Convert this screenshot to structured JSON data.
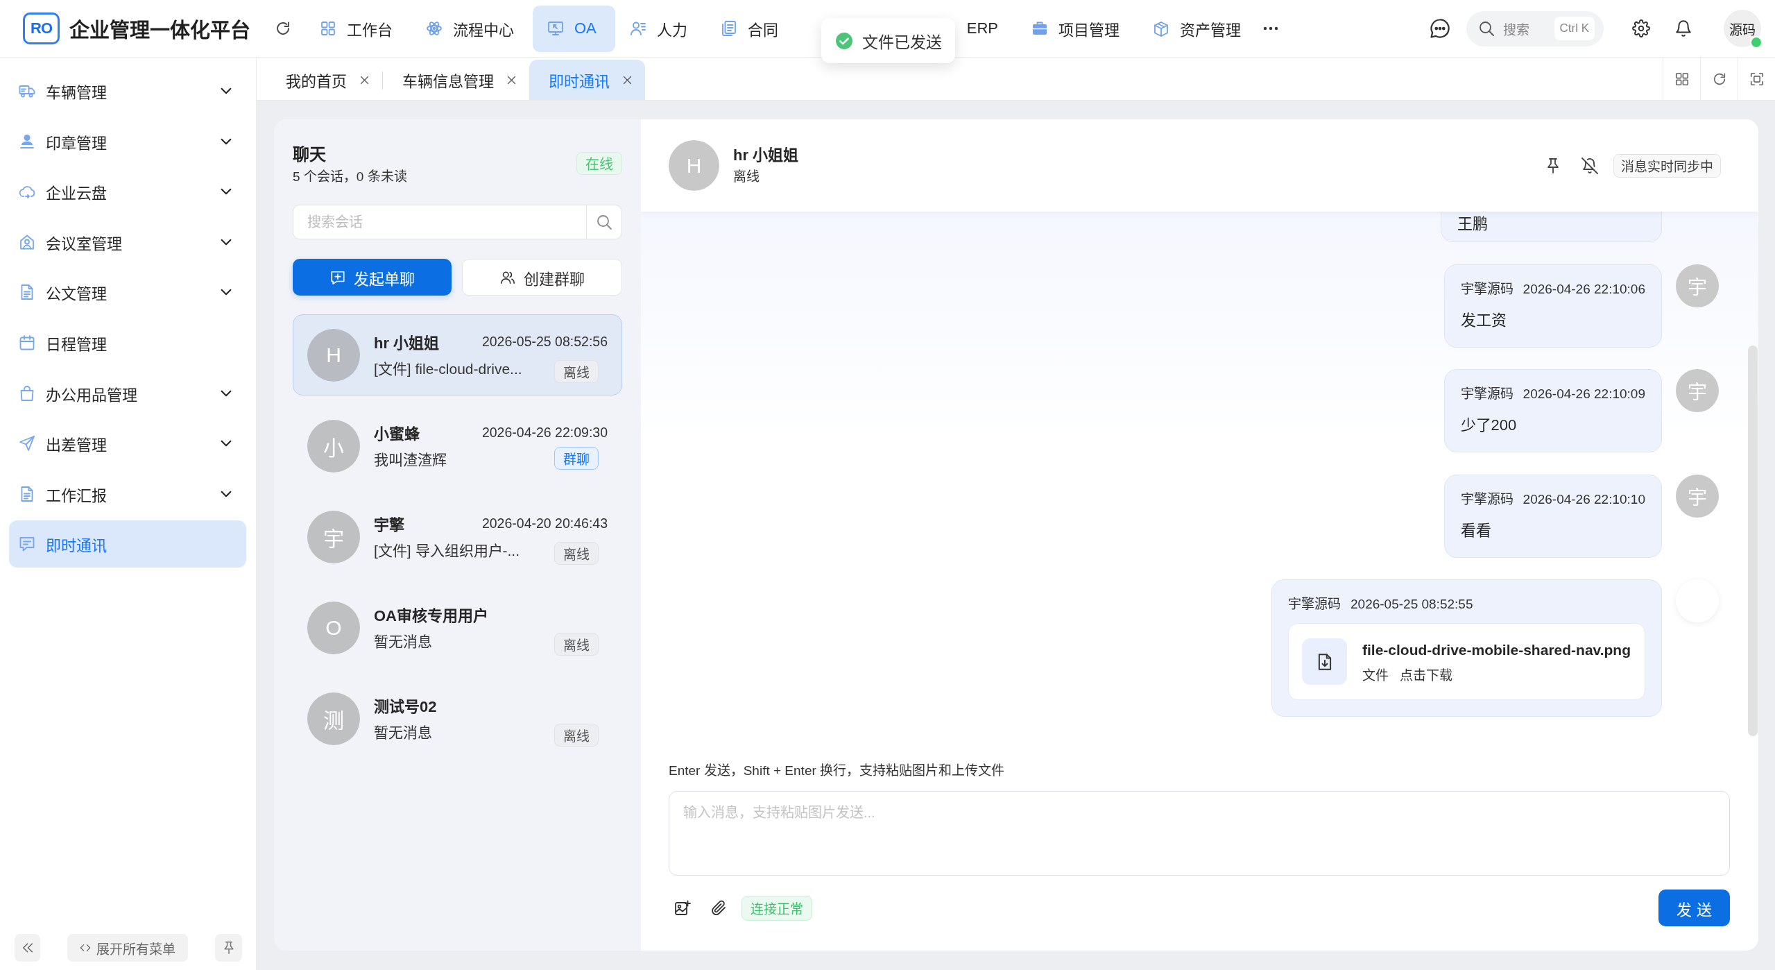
{
  "app": {
    "logo": "RO",
    "title": "企业管理一体化平台"
  },
  "top_nav": [
    {
      "label": "工作台",
      "selected": false
    },
    {
      "label": "流程中心",
      "selected": false
    },
    {
      "label": "OA",
      "selected": true
    },
    {
      "label": "人力",
      "selected": false
    },
    {
      "label": "合同",
      "selected": false
    },
    {
      "label": "ERP",
      "selected": false
    },
    {
      "label": "项目管理",
      "selected": false
    },
    {
      "label": "资产管理",
      "selected": false
    }
  ],
  "topbar": {
    "search": {
      "label": "搜索",
      "shortcut": "Ctrl K"
    },
    "user": {
      "name": "源码",
      "online": true
    }
  },
  "toast": {
    "message": "文件已发送"
  },
  "sidebar": {
    "items": [
      {
        "label": "车辆管理",
        "expandable": true,
        "selected": false
      },
      {
        "label": "印章管理",
        "expandable": true,
        "selected": false
      },
      {
        "label": "企业云盘",
        "expandable": true,
        "selected": false
      },
      {
        "label": "会议室管理",
        "expandable": true,
        "selected": false
      },
      {
        "label": "公文管理",
        "expandable": true,
        "selected": false
      },
      {
        "label": "日程管理",
        "expandable": false,
        "selected": false
      },
      {
        "label": "办公用品管理",
        "expandable": true,
        "selected": false
      },
      {
        "label": "出差管理",
        "expandable": true,
        "selected": false
      },
      {
        "label": "工作汇报",
        "expandable": true,
        "selected": false
      },
      {
        "label": "即时通讯",
        "expandable": false,
        "selected": true
      }
    ],
    "expand_all": "展开所有菜单"
  },
  "tabs": [
    {
      "label": "我的首页",
      "selected": false
    },
    {
      "label": "车辆信息管理",
      "selected": false
    },
    {
      "label": "即时通讯",
      "selected": true
    }
  ],
  "chat_list": {
    "title": "聊天",
    "summary": "5 个会话，0 条未读",
    "status": "在线",
    "search": {
      "placeholder": "搜索会话"
    },
    "actions": [
      {
        "label": "发起单聊",
        "kind": "primary"
      },
      {
        "label": "创建群聊",
        "kind": "default"
      }
    ],
    "conversations": [
      {
        "avatar": "H",
        "name": "hr 小姐姐",
        "time": "2026-05-25 08:52:56",
        "preview": "[文件] file-cloud-drive...",
        "tag": {
          "text": "离线",
          "kind": "status"
        },
        "selected": true
      },
      {
        "avatar": "小",
        "name": "小蜜蜂",
        "time": "2026-04-26 22:09:30",
        "preview": "我叫渣渣辉",
        "tag": {
          "text": "群聊",
          "kind": "group"
        },
        "selected": false
      },
      {
        "avatar": "宇",
        "name": "宇擎",
        "time": "2026-04-20 20:46:43",
        "preview": "[文件] 导入组织用户-...",
        "tag": {
          "text": "离线",
          "kind": "status"
        },
        "selected": false
      },
      {
        "avatar": "O",
        "name": "OA审核专用用户",
        "preview": "暂无消息",
        "tag": {
          "text": "离线",
          "kind": "status"
        },
        "selected": false
      },
      {
        "avatar": "测",
        "name": "测试号02",
        "preview": "暂无消息",
        "tag": {
          "text": "离线",
          "kind": "status"
        },
        "selected": false
      }
    ]
  },
  "chat": {
    "header": {
      "avatar": "H",
      "name": "hr 小姐姐",
      "status": "离线",
      "sync": "消息实时同步中"
    },
    "messages": [
      {
        "kind": "cut",
        "text": "王鹏"
      },
      {
        "kind": "text",
        "sender": "宇擎源码",
        "time": "2026-04-26 22:10:06",
        "text": "发工资",
        "avatar": "宇"
      },
      {
        "kind": "text",
        "sender": "宇擎源码",
        "time": "2026-04-26 22:10:09",
        "text": "少了200",
        "avatar": "宇"
      },
      {
        "kind": "text",
        "sender": "宇擎源码",
        "time": "2026-04-26 22:10:10",
        "text": "看看",
        "avatar": "宇"
      },
      {
        "kind": "file",
        "sender": "宇擎源码",
        "time": "2026-05-25 08:52:55",
        "file_name": "file-cloud-drive-mobile-shared-nav.png",
        "file_type": "文件",
        "action": "点击下载"
      }
    ]
  },
  "composer": {
    "hint": "Enter 发送，Shift + Enter 换行，支持粘贴图片和上传文件",
    "placeholder": "输入消息，支持粘贴图片发送...",
    "connection": "连接正常",
    "send": "发 送"
  }
}
